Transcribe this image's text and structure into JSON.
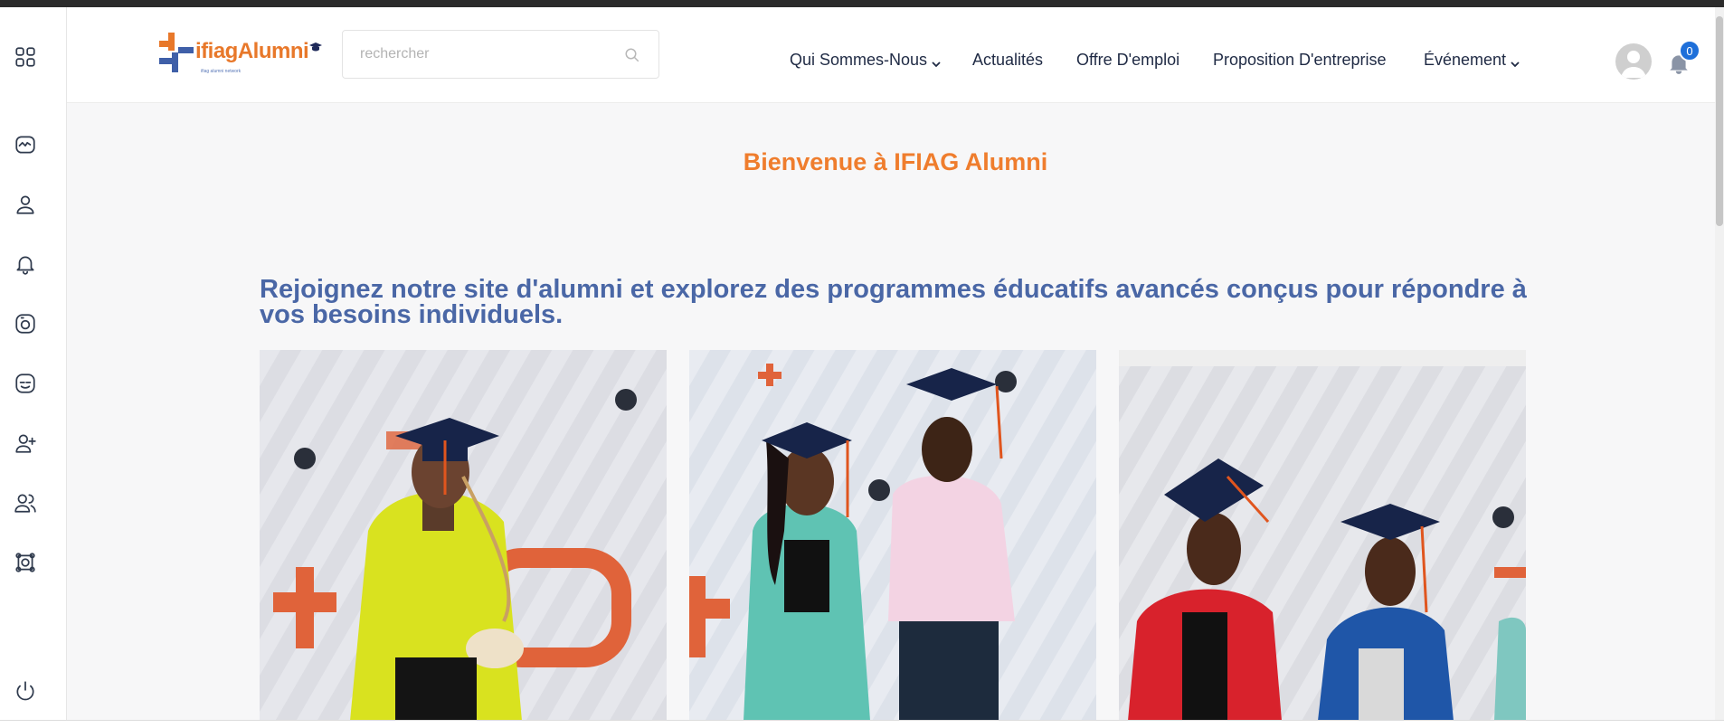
{
  "logo": {
    "prefix": "ifiag",
    "suffix": "Alumni",
    "tagline": "ifiag alumni network"
  },
  "search": {
    "placeholder": "rechercher"
  },
  "nav": [
    {
      "label": "Qui Sommes-Nous",
      "dropdown": true
    },
    {
      "label": "Actualités",
      "dropdown": false
    },
    {
      "label": "Offre D'emploi",
      "dropdown": false
    },
    {
      "label": "Proposition D'entreprise",
      "dropdown": false
    },
    {
      "label": "Événement",
      "dropdown": true
    }
  ],
  "notifications": {
    "count": "0"
  },
  "sidebar": {
    "icons": [
      "apps-grid-icon",
      "activity-icon",
      "user-icon",
      "bell-icon",
      "camera-icon",
      "inbox-icon",
      "add-user-icon",
      "users-icon",
      "settings-icon",
      "power-icon"
    ]
  },
  "main": {
    "welcome": "Bienvenue à IFIAG Alumni",
    "intro": "Rejoignez notre site d'alumni et explorez des programmes éducatifs avancés conçus pour répondre à vos besoins individuels."
  },
  "photos": [
    {
      "name": "graduate-photo-1"
    },
    {
      "name": "graduate-photo-2"
    },
    {
      "name": "graduate-photo-3"
    }
  ],
  "colors": {
    "accent_orange": "#ef7d2d",
    "heading_blue": "#4a67a6",
    "badge_blue": "#1e6fd9"
  }
}
